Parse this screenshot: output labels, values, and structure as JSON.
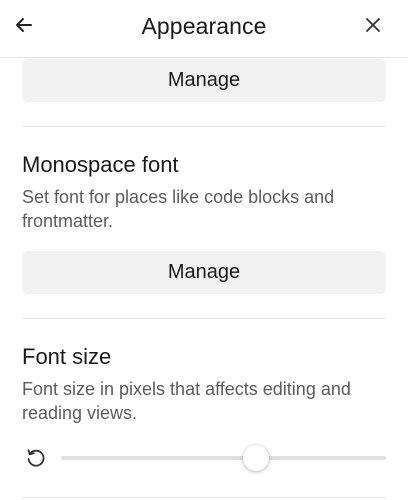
{
  "header": {
    "title": "Appearance",
    "back_icon": "arrow-left-icon",
    "close_icon": "close-icon"
  },
  "sections": [
    {
      "button_label": "Manage"
    },
    {
      "title": "Monospace font",
      "description": "Set font for places like code blocks and frontmatter.",
      "button_label": "Manage"
    },
    {
      "title": "Font size",
      "description": "Font size in pixels that affects editing and reading views.",
      "reset_icon": "reset-icon",
      "slider_fraction": 0.6
    }
  ]
}
